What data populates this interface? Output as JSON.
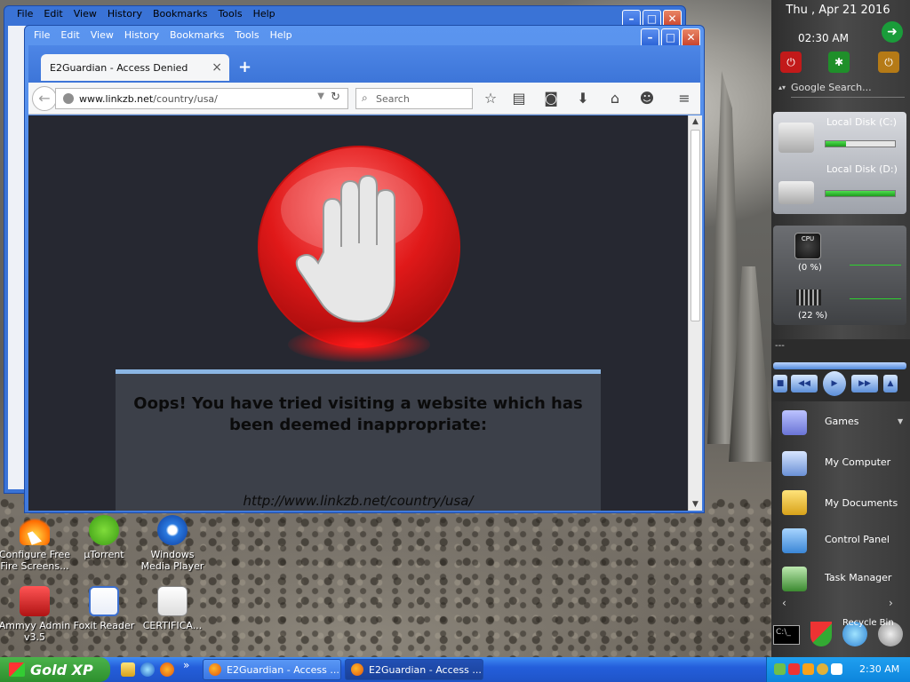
{
  "menu": [
    "File",
    "Edit",
    "View",
    "History",
    "Bookmarks",
    "Tools",
    "Help"
  ],
  "browser": {
    "tab_title": "E2Guardian - Access Denied",
    "url_host": "www.linkzb.net",
    "url_path": "/country/usa/",
    "search_placeholder": "Search"
  },
  "page": {
    "message": "Oops! You have tried visiting a website which has been deemed inappropriate:",
    "blocked_url": "http://www.linkzb.net/country/usa/"
  },
  "desktop_icons": [
    {
      "label": "Configure Free Fire Screens..."
    },
    {
      "label": "µTorrent"
    },
    {
      "label": "Windows Media Player"
    },
    {
      "label": "Ammyy Admin v3.5"
    },
    {
      "label": "Foxit Reader"
    },
    {
      "label": "CERTIFICA..."
    }
  ],
  "sidebar": {
    "date": "Thu , Apr 21 2016",
    "time": "02:30 AM",
    "search_placeholder": "Google Search...",
    "disks": [
      {
        "label": "Local Disk (C:)",
        "used": 0.3
      },
      {
        "label": "Local Disk (D:)",
        "used": 1.0
      }
    ],
    "cpu": "(0 %)",
    "ram": "(22 %)",
    "cpu_icon": "CPU",
    "player_label": "---",
    "menu": [
      "Games",
      "My Computer",
      "My Documents",
      "Control Panel",
      "Task Manager"
    ],
    "recycle": "Recycle Bin"
  },
  "taskbar": {
    "start_label": "Gold XP",
    "tasks": [
      "E2Guardian - Access ...",
      "E2Guardian - Access ..."
    ],
    "clock": "2:30 AM",
    "quicklaunch_more": "»"
  },
  "colors": {
    "accent_blue": "#3f79dd",
    "stop_red": "#e01919",
    "page_bg": "#262831"
  }
}
